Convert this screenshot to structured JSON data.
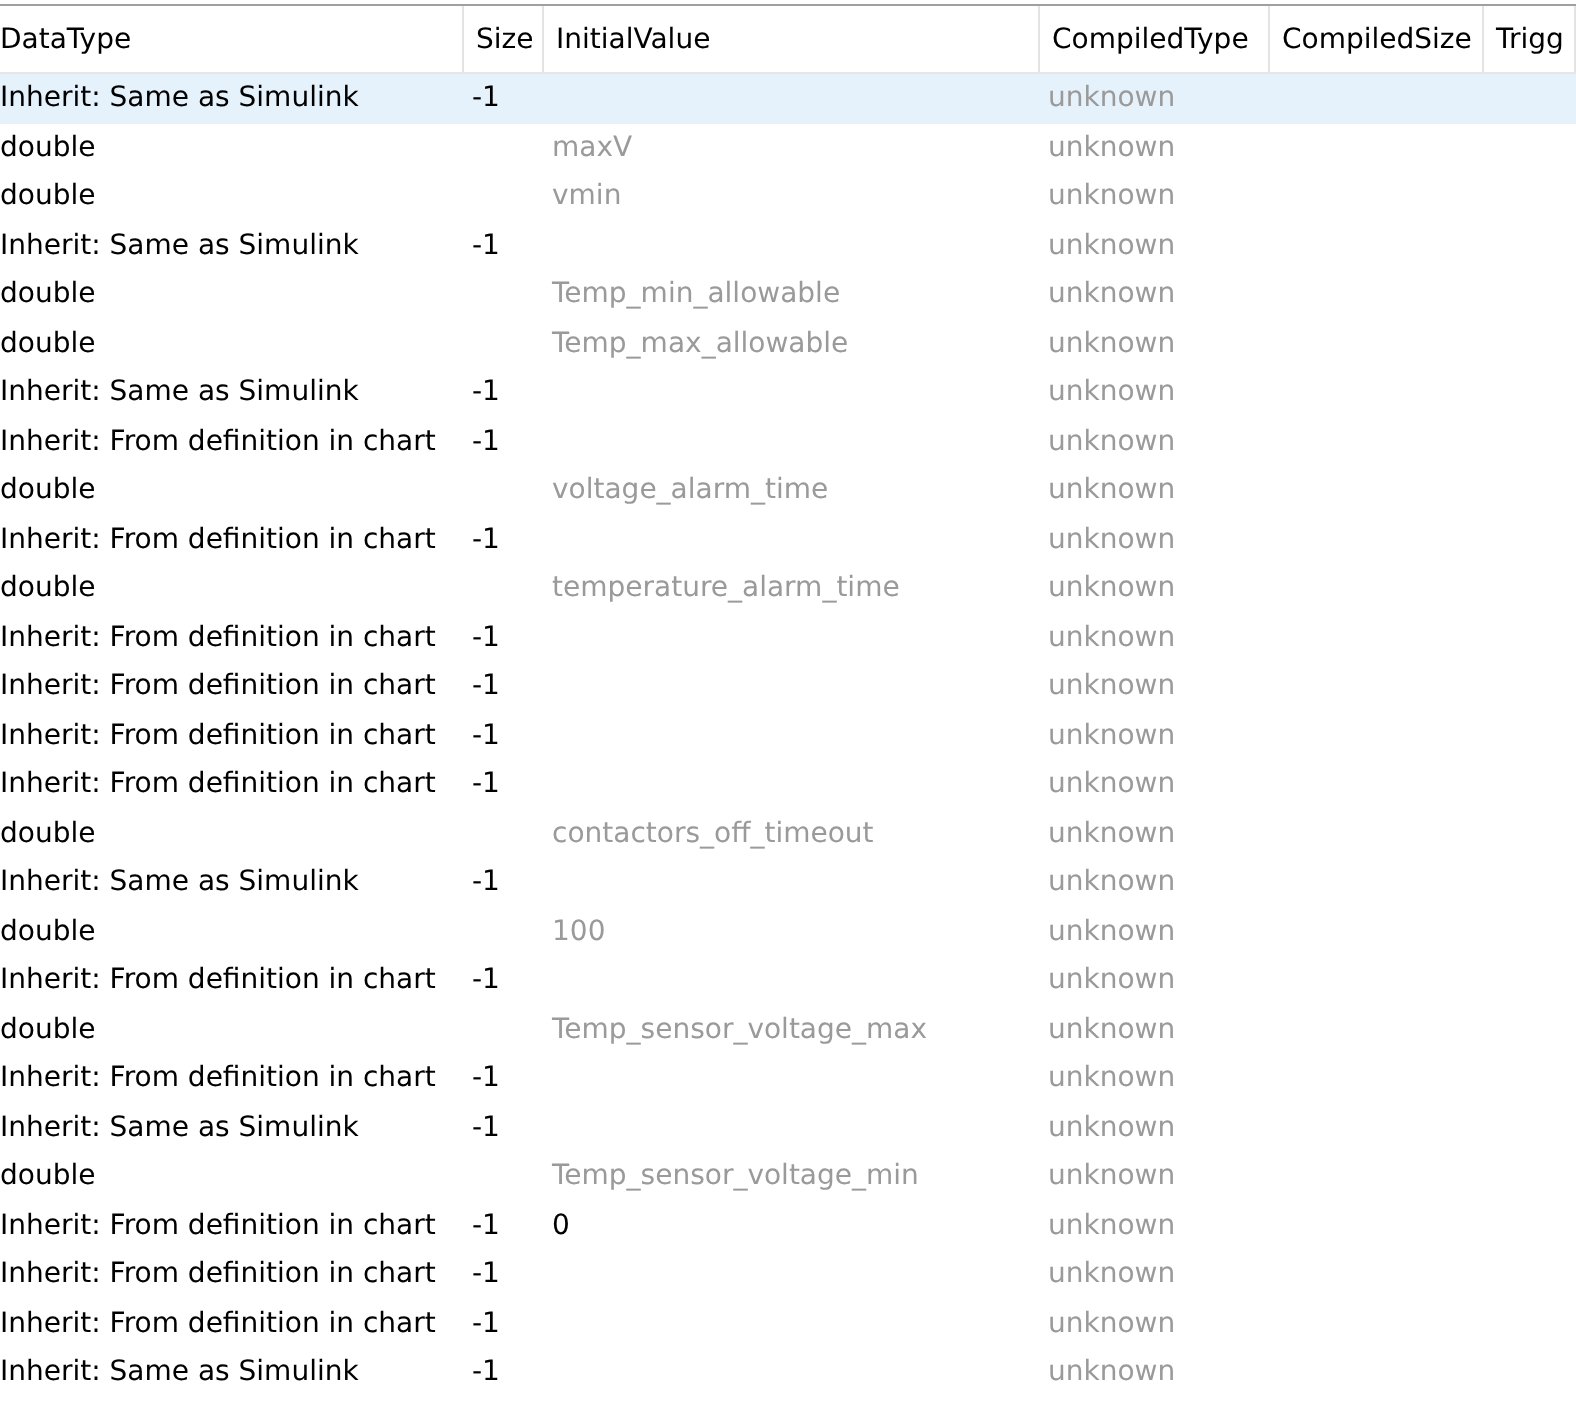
{
  "table": {
    "columns": [
      "DataType",
      "Size",
      "InitialValue",
      "CompiledType",
      "CompiledSize",
      "Trigg"
    ],
    "rows": [
      {
        "data_type": "Inherit: Same as Simulink",
        "size": "-1",
        "compiled_type": "unknown",
        "selected": true
      },
      {
        "data_type": "double",
        "initial_value": {
          "text": "maxV",
          "greyed": true
        },
        "compiled_type": "unknown",
        "selected": false
      },
      {
        "data_type": "double",
        "initial_value": {
          "text": "vmin",
          "greyed": true
        },
        "compiled_type": "unknown",
        "selected": false
      },
      {
        "data_type": "Inherit: Same as Simulink",
        "size": "-1",
        "compiled_type": "unknown",
        "selected": false
      },
      {
        "data_type": "double",
        "initial_value": {
          "text": "Temp_min_allowable",
          "greyed": true
        },
        "compiled_type": "unknown",
        "selected": false
      },
      {
        "data_type": "double",
        "initial_value": {
          "text": "Temp_max_allowable",
          "greyed": true
        },
        "compiled_type": "unknown",
        "selected": false
      },
      {
        "data_type": "Inherit: Same as Simulink",
        "size": "-1",
        "compiled_type": "unknown",
        "selected": false
      },
      {
        "data_type": "Inherit: From definition in chart",
        "size": "-1",
        "compiled_type": "unknown",
        "selected": false
      },
      {
        "data_type": "double",
        "initial_value": {
          "text": "voltage_alarm_time",
          "greyed": true
        },
        "compiled_type": "unknown",
        "selected": false
      },
      {
        "data_type": "Inherit: From definition in chart",
        "size": "-1",
        "compiled_type": "unknown",
        "selected": false
      },
      {
        "data_type": "double",
        "initial_value": {
          "text": "temperature_alarm_time",
          "greyed": true
        },
        "compiled_type": "unknown",
        "selected": false
      },
      {
        "data_type": "Inherit: From definition in chart",
        "size": "-1",
        "compiled_type": "unknown",
        "selected": false
      },
      {
        "data_type": "Inherit: From definition in chart",
        "size": "-1",
        "compiled_type": "unknown",
        "selected": false
      },
      {
        "data_type": "Inherit: From definition in chart",
        "size": "-1",
        "compiled_type": "unknown",
        "selected": false
      },
      {
        "data_type": "Inherit: From definition in chart",
        "size": "-1",
        "compiled_type": "unknown",
        "selected": false
      },
      {
        "data_type": "double",
        "initial_value": {
          "text": "contactors_off_timeout",
          "greyed": true
        },
        "compiled_type": "unknown",
        "selected": false
      },
      {
        "data_type": "Inherit: Same as Simulink",
        "size": "-1",
        "compiled_type": "unknown",
        "selected": false
      },
      {
        "data_type": "double",
        "initial_value": {
          "text": "100",
          "greyed": true
        },
        "compiled_type": "unknown",
        "selected": false
      },
      {
        "data_type": "Inherit: From definition in chart",
        "size": "-1",
        "compiled_type": "unknown",
        "selected": false
      },
      {
        "data_type": "double",
        "initial_value": {
          "text": "Temp_sensor_voltage_max",
          "greyed": true
        },
        "compiled_type": "unknown",
        "selected": false
      },
      {
        "data_type": "Inherit: From definition in chart",
        "size": "-1",
        "compiled_type": "unknown",
        "selected": false
      },
      {
        "data_type": "Inherit: Same as Simulink",
        "size": "-1",
        "compiled_type": "unknown",
        "selected": false
      },
      {
        "data_type": "double",
        "initial_value": {
          "text": "Temp_sensor_voltage_min",
          "greyed": true
        },
        "compiled_type": "unknown",
        "selected": false
      },
      {
        "data_type": "Inherit: From definition in chart",
        "size": "-1",
        "initial_value": {
          "text": "0",
          "greyed": false
        },
        "compiled_type": "unknown",
        "selected": false
      },
      {
        "data_type": "Inherit: From definition in chart",
        "size": "-1",
        "compiled_type": "unknown",
        "selected": false
      },
      {
        "data_type": "Inherit: From definition in chart",
        "size": "-1",
        "compiled_type": "unknown",
        "selected": false
      },
      {
        "data_type": "Inherit: Same as Simulink",
        "size": "-1",
        "compiled_type": "unknown",
        "selected": false
      }
    ]
  }
}
